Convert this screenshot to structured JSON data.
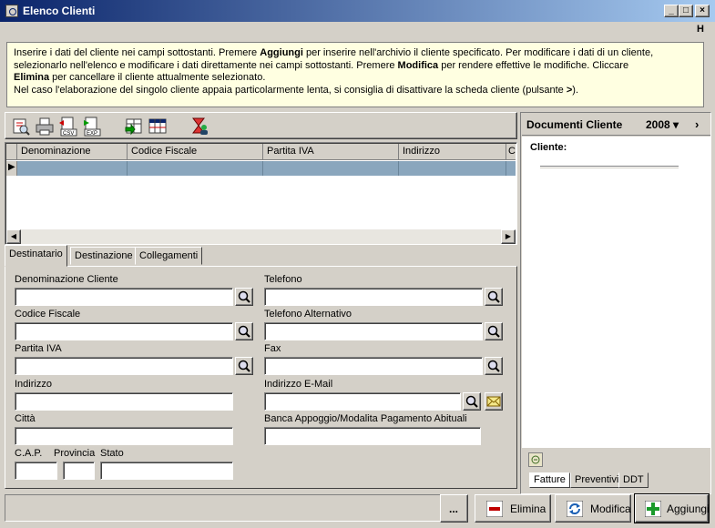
{
  "window": {
    "title": "Elenco Clienti",
    "minimize": "_",
    "maximize": "□",
    "close": "×",
    "menu_help": "H"
  },
  "info": {
    "line1_a": "Inserire i dati del cliente nei campi sottostanti. Premere ",
    "line1_b": "Aggiungi",
    "line1_c": " per inserire nell'archivio il cliente specificato. Per modificare i dati di un cliente,",
    "line2_a": "selezionarlo nell'elenco e modificare i dati direttamente nei campi  sottostanti. Premere ",
    "line2_b": "Modifica",
    "line2_c": " per rendere effettive le modifiche. Cliccare",
    "line3_a": "Elimina",
    "line3_b": " per cancellare il cliente attualmente selezionato.",
    "line4_a": "Nel caso l'elaborazione del singolo cliente appaia particolarmente lenta, si consiglia di disattivare la scheda cliente (pulsante ",
    "line4_b": ">",
    "line4_c": ")."
  },
  "toolbar": {
    "icons": [
      "search-document-icon",
      "print-icon",
      "export-csv-icon",
      "export-exp-icon",
      "import-icon",
      "columns-icon",
      "hourglass-user-icon"
    ],
    "csv_label": "CSV",
    "exp_label": "EXP"
  },
  "grid": {
    "columns": [
      "Denominazione",
      "Codice Fiscale",
      "Partita IVA",
      "Indirizzo",
      "C"
    ],
    "selected_row_indicator": "▶"
  },
  "tabs": [
    "Destinatario",
    "Destinazione",
    "Collegamenti"
  ],
  "form": {
    "denominazione_label": "Denominazione Cliente",
    "denominazione_value": "",
    "codice_fiscale_label": "Codice Fiscale",
    "codice_fiscale_value": "",
    "partita_iva_label": "Partita IVA",
    "partita_iva_value": "",
    "indirizzo_label": "Indirizzo",
    "indirizzo_value": "",
    "citta_label": "Città",
    "citta_value": "",
    "cap_label": "C.A.P.",
    "cap_value": "",
    "provincia_label": "Provincia",
    "provincia_value": "",
    "stato_label": "Stato",
    "stato_value": "",
    "telefono_label": "Telefono",
    "telefono_value": "",
    "telefono_alt_label": "Telefono Alternativo",
    "telefono_alt_value": "",
    "fax_label": "Fax",
    "fax_value": "",
    "email_label": "Indirizzo E-Mail",
    "email_value": "",
    "banca_label": "Banca Appoggio/Modalita Pagamento Abituali",
    "banca_value": ""
  },
  "documents": {
    "title": "Documenti Cliente",
    "year": "2008 ▾",
    "next": "›",
    "cliente_label": "Cliente:",
    "tabs": [
      "Fatture",
      "Preventivi",
      "DDT"
    ]
  },
  "buttons": {
    "more": "...",
    "elimina": "Elimina",
    "modifica": "Modifica",
    "aggiungi": "Aggiungi"
  },
  "colors": {
    "title_start": "#0a246a",
    "title_end": "#a6caf0",
    "info_bg": "#ffffe1",
    "selected_row": "#8aa6bd",
    "face": "#d4d0c8"
  }
}
